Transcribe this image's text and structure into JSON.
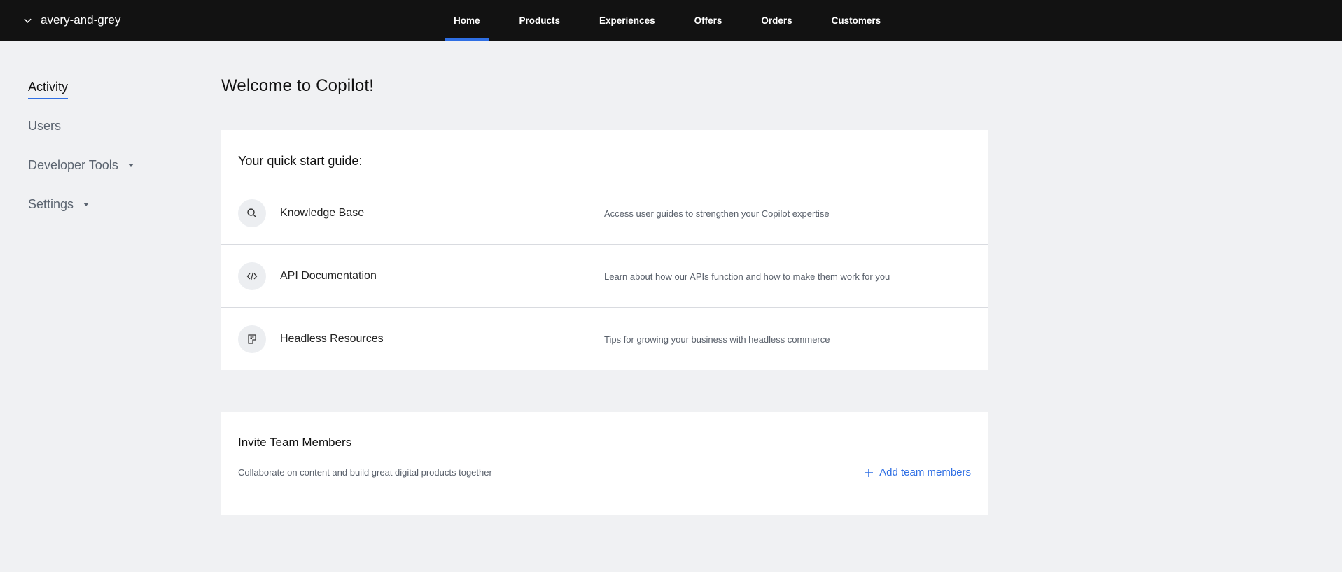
{
  "topbar": {
    "org_name": "avery-and-grey",
    "nav": [
      {
        "label": "Home",
        "active": true
      },
      {
        "label": "Products",
        "active": false
      },
      {
        "label": "Experiences",
        "active": false
      },
      {
        "label": "Offers",
        "active": false
      },
      {
        "label": "Orders",
        "active": false
      },
      {
        "label": "Customers",
        "active": false
      }
    ]
  },
  "sidebar": {
    "items": [
      {
        "label": "Activity",
        "active": true
      },
      {
        "label": "Users",
        "active": false
      },
      {
        "label": "Developer Tools",
        "has_dropdown": true
      },
      {
        "label": "Settings",
        "has_dropdown": true
      }
    ]
  },
  "main": {
    "title": "Welcome to Copilot!",
    "guide": {
      "heading": "Your quick start guide:",
      "rows": [
        {
          "icon": "search-icon",
          "title": "Knowledge Base",
          "desc": "Access user guides to strengthen your Copilot expertise"
        },
        {
          "icon": "code-icon",
          "title": "API Documentation",
          "desc": "Learn about how our APIs function and how to make them work for you"
        },
        {
          "icon": "document-icon",
          "title": "Headless Resources",
          "desc": "Tips for growing your business with headless commerce"
        }
      ]
    },
    "invite": {
      "heading": "Invite Team Members",
      "desc": "Collaborate on content and build great digital products together",
      "action_label": "Add team members"
    }
  },
  "colors": {
    "accent": "#2f6fe4",
    "topbar_bg": "#121212",
    "page_bg": "#f0f1f3"
  }
}
